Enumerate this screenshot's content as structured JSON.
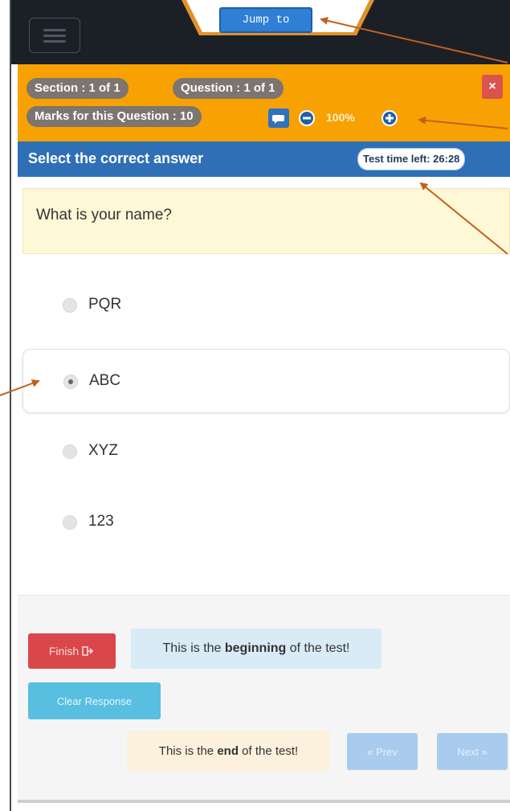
{
  "header": {
    "jump_label": "Jump to"
  },
  "status": {
    "section": "Section : 1 of 1",
    "question": "Question : 1 of 1",
    "marks": "Marks for this Question : 10",
    "zoom": "100%",
    "close_label": "×"
  },
  "title_bar": {
    "title": "Select the correct answer",
    "timer": "Test time left: 26:28"
  },
  "question": {
    "text": "What is your name?"
  },
  "options": [
    {
      "label": "PQR",
      "selected": false
    },
    {
      "label": "ABC",
      "selected": true
    },
    {
      "label": "XYZ",
      "selected": false
    },
    {
      "label": "123",
      "selected": false
    }
  ],
  "footer": {
    "finish_label": "Finish",
    "finish_icon": "sign-out-icon",
    "begin_prefix": "This is the ",
    "begin_strong": "beginning",
    "begin_suffix": " of the test!",
    "clear_label": "Clear Response",
    "end_prefix": "This is the ",
    "end_strong": "end",
    "end_suffix": " of the test!",
    "prev_label": "« Prev",
    "next_label": "Next »"
  },
  "colors": {
    "accent_orange": "#f8a102",
    "title_blue": "#2f6fb6",
    "danger_red": "#d9474a",
    "info_cyan": "#58bfe0",
    "annotation_arrow": "#c0611f"
  }
}
